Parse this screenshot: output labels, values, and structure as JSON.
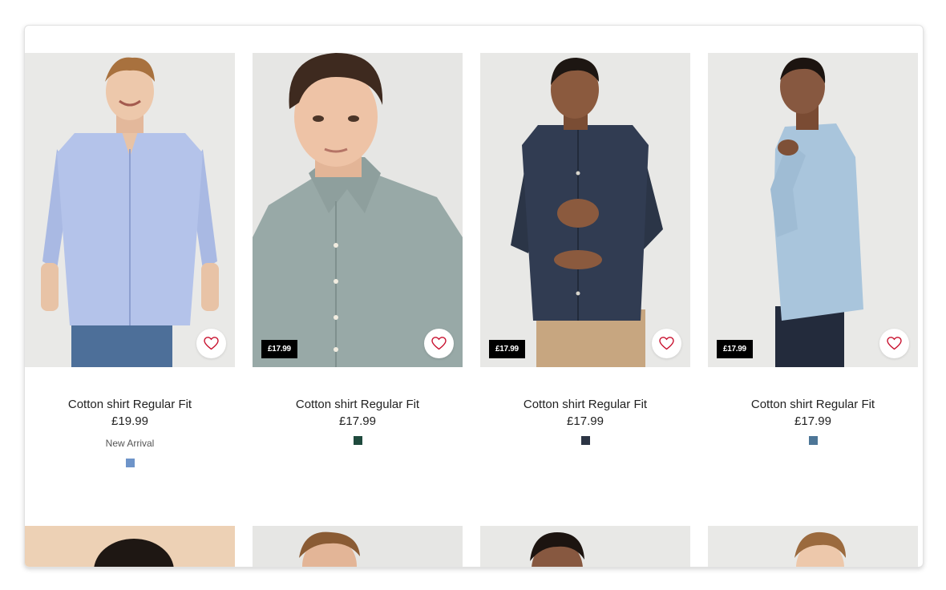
{
  "products": [
    {
      "title": "Cotton shirt Regular Fit",
      "price": "£19.99",
      "badge": "",
      "tag": "New Arrival",
      "swatch_color": "#6e94c9",
      "favorite_icon": "heart-outline-icon"
    },
    {
      "title": "Cotton shirt Regular Fit",
      "price": "£17.99",
      "badge": "£17.99",
      "tag": "",
      "swatch_color": "#1f4a3d",
      "favorite_icon": "heart-outline-icon"
    },
    {
      "title": "Cotton shirt Regular Fit",
      "price": "£17.99",
      "badge": "£17.99",
      "tag": "",
      "swatch_color": "#2c3444",
      "favorite_icon": "heart-outline-icon"
    },
    {
      "title": "Cotton shirt Regular Fit",
      "price": "£17.99",
      "badge": "£17.99",
      "tag": "",
      "swatch_color": "#4d7697",
      "favorite_icon": "heart-outline-icon"
    }
  ],
  "colors": {
    "heart": "#c8102e",
    "badge_bg": "#000000",
    "image_bg": "#ebebeb"
  }
}
